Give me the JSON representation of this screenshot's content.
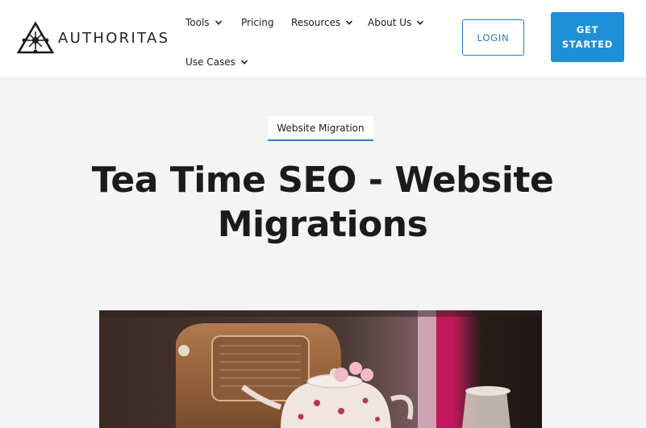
{
  "brand": {
    "name": "AUTHORITAS"
  },
  "nav": {
    "tools": "Tools",
    "pricing": "Pricing",
    "resources": "Resources",
    "about": "About Us",
    "use_cases": "Use Cases"
  },
  "buttons": {
    "login": "LOGIN",
    "cta_line1": "GET",
    "cta_line2": "STARTED"
  },
  "article": {
    "category": "Website Migration",
    "title_line1": "Tea Time SEO - Website",
    "title_line2": "Migrations"
  },
  "colors": {
    "accent": "#1d8fd8",
    "outline": "#1f7fc2",
    "background": "#f4f4f4"
  }
}
